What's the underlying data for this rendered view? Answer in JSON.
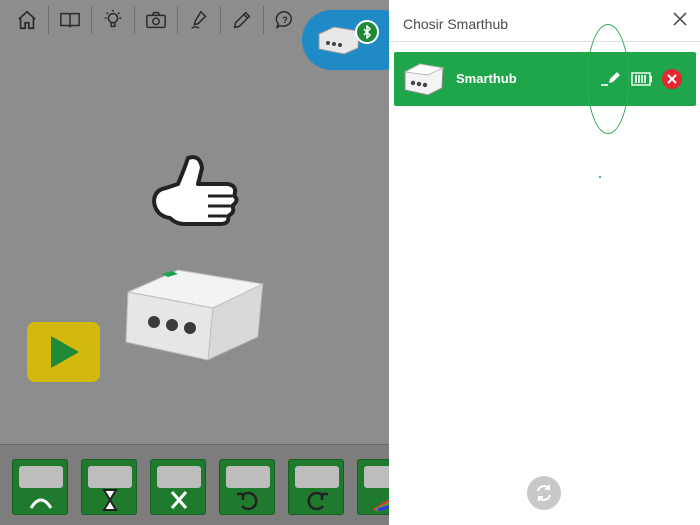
{
  "panel": {
    "title": "Chosir Smarthub",
    "close_icon": "close-icon",
    "hub_row": {
      "name": "Smarthub",
      "color": "#1fa64a",
      "icons": [
        "edit-icon",
        "battery-icon",
        "disconnect-icon"
      ]
    },
    "refresh_icon": "refresh-icon"
  },
  "toolbar": {
    "icons": [
      "home-icon",
      "book-icon",
      "lightbulb-icon",
      "camera-icon",
      "microphone-icon",
      "pencil-icon",
      "help-icon"
    ]
  },
  "canvas": {
    "connected_hub_badge": "bluetooth-icon",
    "play_icon": "play-icon",
    "palette_blocks": [
      "motor-power-block",
      "motor-time-block",
      "motor-stop-block",
      "motor-ccw-block",
      "motor-cw-block",
      "light-block"
    ]
  },
  "colors": {
    "accent_green": "#1fa64a",
    "pill_blue": "#1e8bc7",
    "play_yellow": "#d4b80e",
    "disconnect_red": "#e3262f"
  }
}
